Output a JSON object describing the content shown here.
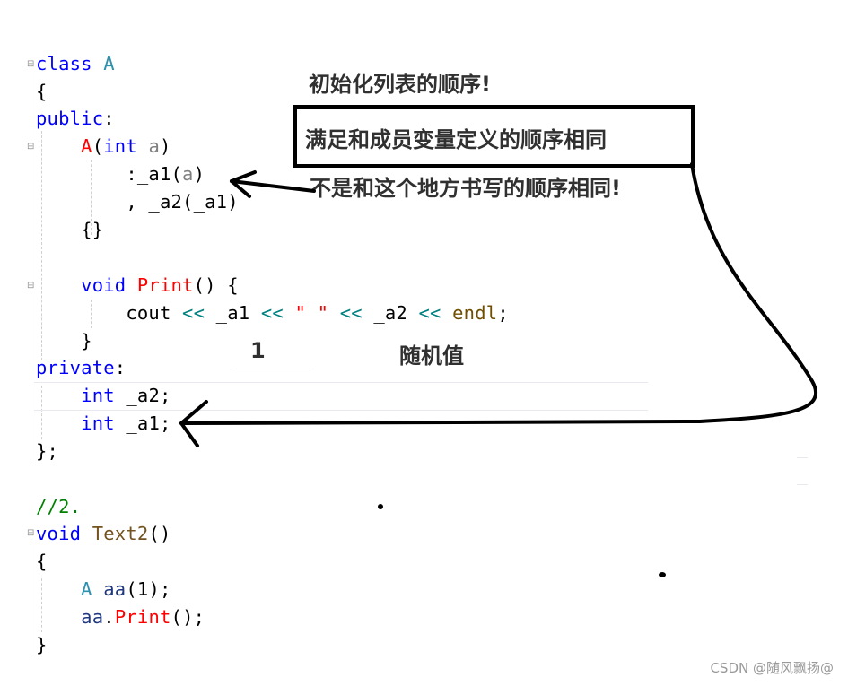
{
  "code": {
    "lines": [
      {
        "tokens": [
          [
            "kw",
            "class"
          ],
          [
            "",
            ""
          ],
          [
            "",
            "  "
          ],
          [
            "type",
            "A"
          ]
        ]
      },
      {
        "text": "{"
      },
      {
        "tokens": [
          [
            "kw",
            "public"
          ],
          [
            "",
            ":"
          ]
        ]
      },
      {
        "tokens": [
          [
            "",
            "    "
          ],
          [
            "fn",
            "A"
          ],
          [
            "",
            "("
          ],
          [
            "kw",
            "int"
          ],
          [
            "",
            " "
          ],
          [
            "param",
            "a"
          ],
          [
            "",
            ")"
          ]
        ]
      },
      {
        "tokens": [
          [
            "",
            "        :_a1("
          ],
          [
            "param",
            "a"
          ],
          [
            "",
            ")"
          ]
        ]
      },
      {
        "text": "        , _a2(_a1)"
      },
      {
        "text": "    {}"
      },
      {
        "text": ""
      },
      {
        "tokens": [
          [
            "",
            "    "
          ],
          [
            "kw",
            "void"
          ],
          [
            "",
            " "
          ],
          [
            "fn",
            "Print"
          ],
          [
            "",
            "() {"
          ]
        ]
      },
      {
        "tokens": [
          [
            "",
            "        cout "
          ],
          [
            "op",
            "<<"
          ],
          [
            "",
            " _a1 "
          ],
          [
            "op",
            "<<"
          ],
          [
            "",
            " "
          ],
          [
            "str",
            "\" \""
          ],
          [
            "",
            " "
          ],
          [
            "op",
            "<<"
          ],
          [
            "",
            " _a2 "
          ],
          [
            "op",
            "<<"
          ],
          [
            "",
            " "
          ],
          [
            "mac",
            "endl"
          ],
          [
            "",
            ";"
          ]
        ]
      },
      {
        "text": "    }"
      },
      {
        "tokens": [
          [
            "kw",
            "private"
          ],
          [
            "",
            ":"
          ]
        ]
      },
      {
        "tokens": [
          [
            "",
            "    "
          ],
          [
            "kw",
            "int"
          ],
          [
            "",
            " _a2;"
          ]
        ]
      },
      {
        "tokens": [
          [
            "",
            "    "
          ],
          [
            "kw",
            "int"
          ],
          [
            "",
            " _a1;"
          ]
        ]
      },
      {
        "text": "};"
      },
      {
        "text": ""
      },
      {
        "tokens": [
          [
            "cmt",
            "//2."
          ]
        ]
      },
      {
        "tokens": [
          [
            "kw",
            "void"
          ],
          [
            "",
            " "
          ],
          [
            "fn2",
            "Text2"
          ],
          [
            "",
            "()"
          ]
        ]
      },
      {
        "text": "{"
      },
      {
        "tokens": [
          [
            "",
            "    "
          ],
          [
            "type",
            "A"
          ],
          [
            "",
            " "
          ],
          [
            "var",
            "aa"
          ],
          [
            "",
            "(1);"
          ]
        ]
      },
      {
        "tokens": [
          [
            "",
            "    "
          ],
          [
            "var",
            "aa"
          ],
          [
            "",
            "."
          ],
          [
            "fn",
            "Print"
          ],
          [
            "",
            "();"
          ]
        ]
      },
      {
        "text": "}"
      }
    ]
  },
  "annotations": {
    "title": "初始化列表的顺序!",
    "boxed": "满足和成员变量定义的顺序相同",
    "note": "不是和这个地方书写的顺序相同!",
    "value_a1": "1",
    "value_a2": "随机值"
  },
  "watermark": "CSDN @随风飘扬@"
}
